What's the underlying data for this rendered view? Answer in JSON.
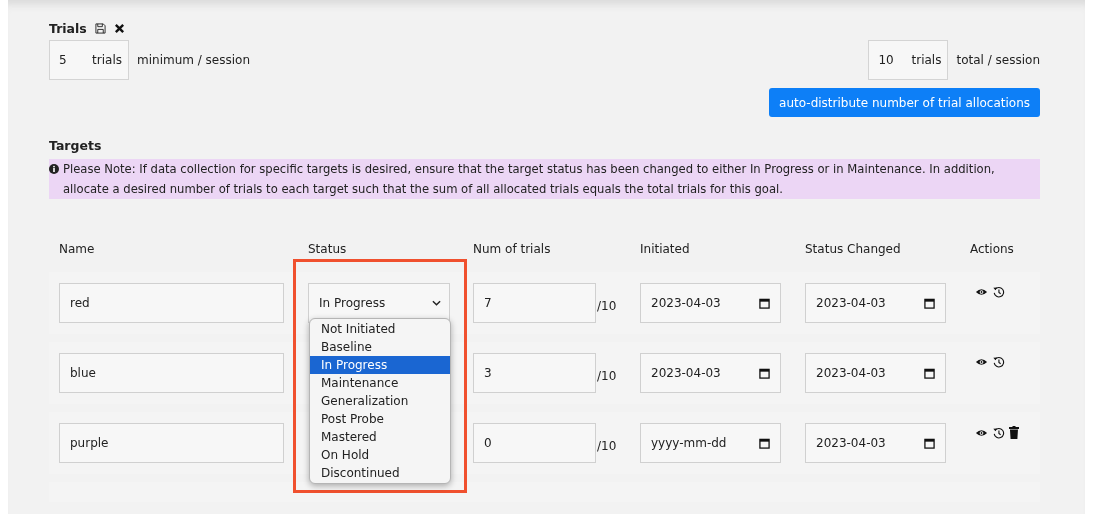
{
  "trials": {
    "title": "Trials",
    "minimum": {
      "value": "5",
      "unit": "trials",
      "label": "minimum / session"
    },
    "total": {
      "value": "10",
      "unit": "trials",
      "label": "total / session"
    },
    "distribute_button": "auto-distribute number of trial allocations"
  },
  "targets": {
    "title": "Targets",
    "note": "Please Note: If data collection for specific targets is desired, ensure that the target status has been changed to either In Progress or in Maintenance. In addition, allocate a desired number of trials to each target such that the sum of all allocated trials equals the total trials for this goal.",
    "columns": [
      "Name",
      "Status",
      "Num of trials",
      "Initiated",
      "Status Changed",
      "Actions"
    ],
    "rows": [
      {
        "name": "red",
        "status": "In Progress",
        "trials": "7",
        "max": "/10",
        "initiated": "2023-04-03",
        "changed": "2023-04-03",
        "deletable": false
      },
      {
        "name": "blue",
        "trials": "3",
        "max": "/10",
        "initiated": "2023-04-03",
        "changed": "2023-04-03",
        "deletable": false
      },
      {
        "name": "purple",
        "trials": "0",
        "max": "/10",
        "initiated": "yyyy-mm-dd",
        "changed": "2023-04-03",
        "deletable": true
      }
    ],
    "status_dropdown": {
      "highlighted": true,
      "options": [
        {
          "label": "Not Initiated",
          "selected": false
        },
        {
          "label": "Baseline",
          "selected": false
        },
        {
          "label": "In Progress",
          "selected": true
        },
        {
          "label": "Maintenance",
          "selected": false
        },
        {
          "label": "Generalization",
          "selected": false
        },
        {
          "label": "Post Probe",
          "selected": false
        },
        {
          "label": "Mastered",
          "selected": false
        },
        {
          "label": "On Hold",
          "selected": false
        },
        {
          "label": "Discontinued",
          "selected": false
        }
      ]
    }
  }
}
